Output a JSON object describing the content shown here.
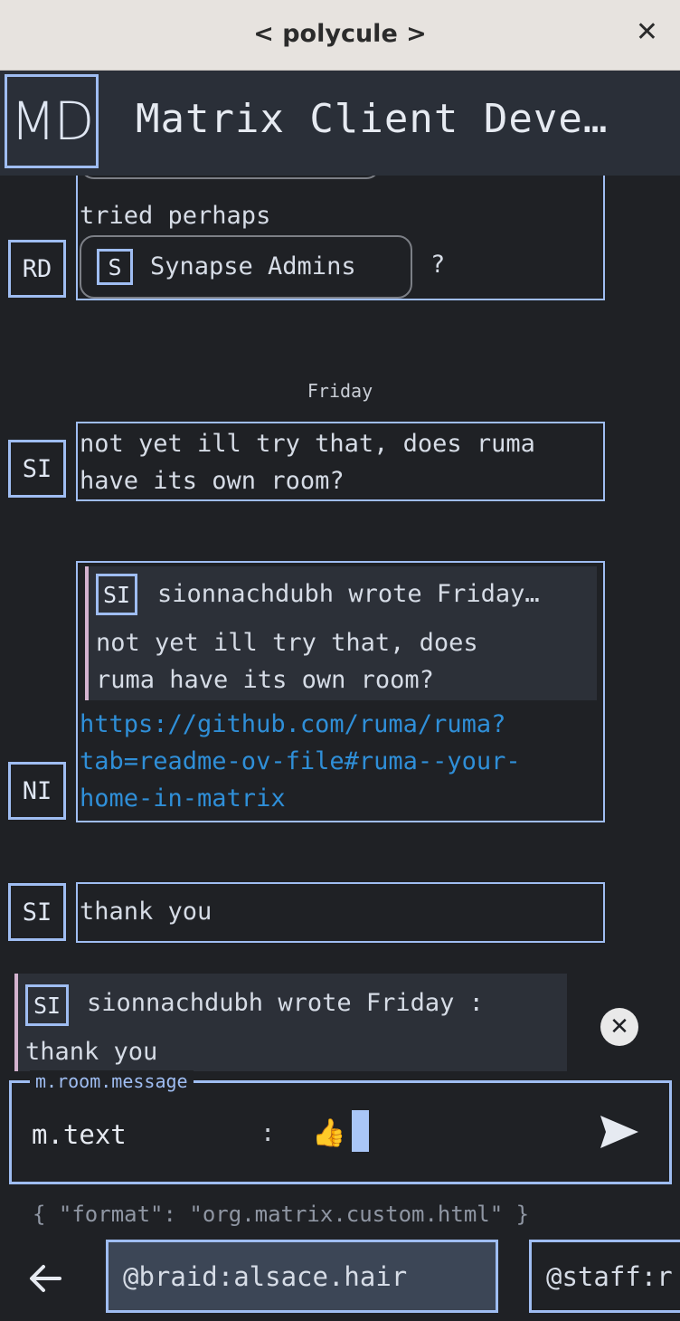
{
  "window": {
    "title": "< polycule >",
    "close_label": "✕"
  },
  "room": {
    "avatar_initials": "MD",
    "name": "Matrix Client Deve…"
  },
  "timeline": {
    "msg1": {
      "avatar": "RD",
      "line1": "tried perhaps",
      "pill_avatar": "S",
      "pill_label": "Synapse Admins",
      "suffix": "?"
    },
    "date_separator": "Friday",
    "msg2": {
      "avatar": "SI",
      "line1": "not yet ill try that, does ruma",
      "line2": "have its own room?"
    },
    "msg3": {
      "avatar": "NI",
      "quote_avatar": "SI",
      "quote_header": "sionnachdubh wrote Friday…",
      "quote_line1": "not yet ill try that, does",
      "quote_line2": "ruma have its own room?",
      "link_line1": "https://github.com/ruma/ruma?",
      "link_line2": "tab=readme-ov-file#ruma--your-",
      "link_line3": "home-in-matrix"
    },
    "msg4": {
      "avatar": "SI",
      "text": "thank you"
    }
  },
  "reply_preview": {
    "avatar": "SI",
    "header": "sionnachdubh wrote Friday :",
    "text": "thank you",
    "cancel_icon": "✕"
  },
  "composer": {
    "legend": "m.room.message",
    "key": "m.text",
    "separator": ":",
    "value": "👍"
  },
  "format_line": "{ \"format\": \"org.matrix.custom.html\" }",
  "accounts": [
    "@braid:alsace.hair",
    "@staff:r"
  ],
  "colors": {
    "accent": "#9fbdf2",
    "link": "#2f8fd8",
    "quote_bar": "#d4b3cf",
    "background": "#1f2125"
  }
}
